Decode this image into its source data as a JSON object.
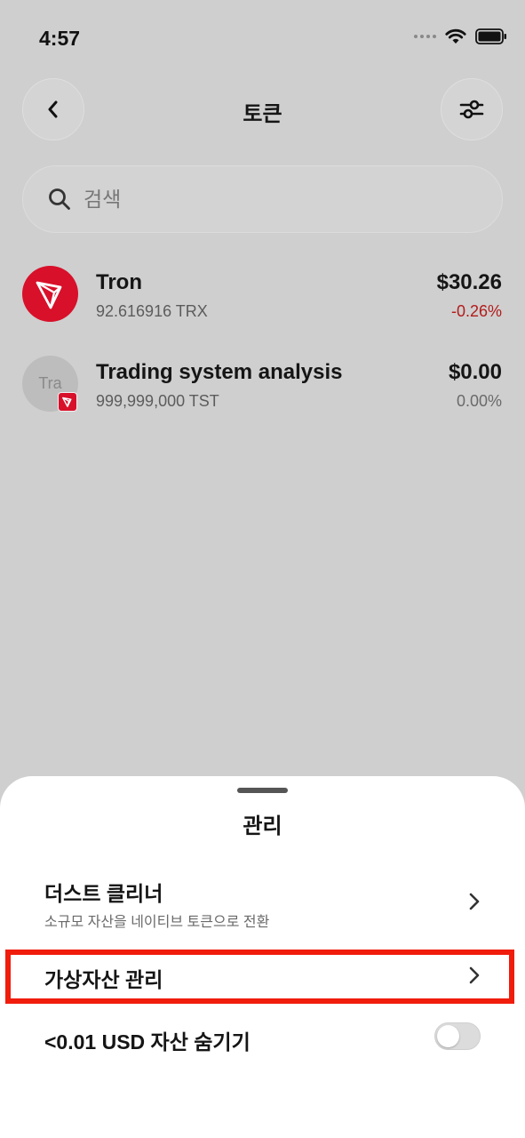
{
  "status_bar": {
    "time": "4:57",
    "icons": [
      "cellular-dots-icon",
      "wifi-icon",
      "battery-icon"
    ]
  },
  "header": {
    "title": "토큰",
    "back_icon": "chevron-left-icon",
    "filter_icon": "sliders-icon"
  },
  "search": {
    "placeholder": "검색",
    "value": ""
  },
  "tokens": [
    {
      "name": "Tron",
      "amount": "92.616916 TRX",
      "value": "$30.26",
      "change": "-0.26%",
      "change_color": "#b31b1b",
      "logo": "tron-logo-icon"
    },
    {
      "name": "Trading system analysis",
      "amount": "999,999,000 TST",
      "value": "$0.00",
      "change": "0.00%",
      "change_color": "#6a6a6a",
      "logo_text": "Tra",
      "badge": "tron-badge-icon"
    }
  ],
  "sheet": {
    "title": "관리",
    "items": [
      {
        "title": "더스트 클리너",
        "subtitle": "소규모 자산을 네이티브 토큰으로 전환"
      },
      {
        "title": "가상자산 관리",
        "highlighted": true
      },
      {
        "title": "<0.01 USD 자산 숨기기",
        "toggle_on": false
      }
    ]
  },
  "colors": {
    "accent_red": "#d8102a",
    "highlight_border": "#f01c0c"
  }
}
